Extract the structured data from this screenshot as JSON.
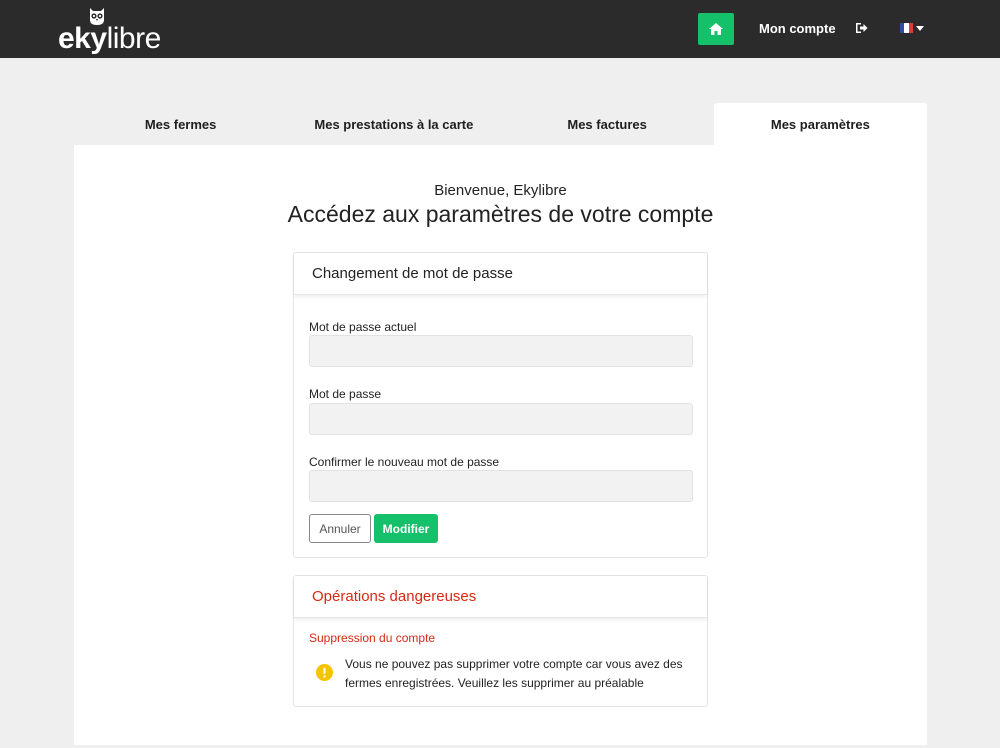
{
  "navbar": {
    "brand_bold": "eky",
    "brand_light": "libre",
    "account_label": "Mon compte",
    "flag_colors": [
      "#2d4ea0",
      "#ffffff",
      "#e13a3a"
    ],
    "icons": [
      "owl-logo-icon",
      "home-icon",
      "logout-icon",
      "flag-fr-icon",
      "caret-down-icon"
    ]
  },
  "tabs": [
    {
      "label": "Mes fermes",
      "active": false
    },
    {
      "label": "Mes prestations à la carte",
      "active": false
    },
    {
      "label": "Mes factures",
      "active": false
    },
    {
      "label": "Mes paramètres",
      "active": true
    }
  ],
  "main": {
    "welcome": "Bienvenue, Ekylibre",
    "heading": "Accédez aux paramètres de votre compte"
  },
  "password_card": {
    "title": "Changement de mot de passe",
    "fields": [
      {
        "label": "Mot de passe actuel",
        "value": "",
        "placeholder": ""
      },
      {
        "label": "Mot de passe",
        "value": "",
        "placeholder": ""
      },
      {
        "label": "Confirmer le nouveau mot de passe",
        "value": "",
        "placeholder": ""
      }
    ],
    "cancel_label": "Annuler",
    "submit_label": "Modifier"
  },
  "danger_card": {
    "title": "Opérations dangereuses",
    "subtitle": "Suppression du compte",
    "message": "Vous ne pouvez pas supprimer votre compte car vous avez des fermes enregistrées. Veuillez les supprimer au préalable",
    "icon": "warning-icon"
  },
  "colors": {
    "navbar_bg": "#2b2b2b",
    "accent_green": "#14c06a",
    "danger_red": "#d42a12",
    "warning_yellow": "#f4c400",
    "page_bg": "#efefef"
  }
}
